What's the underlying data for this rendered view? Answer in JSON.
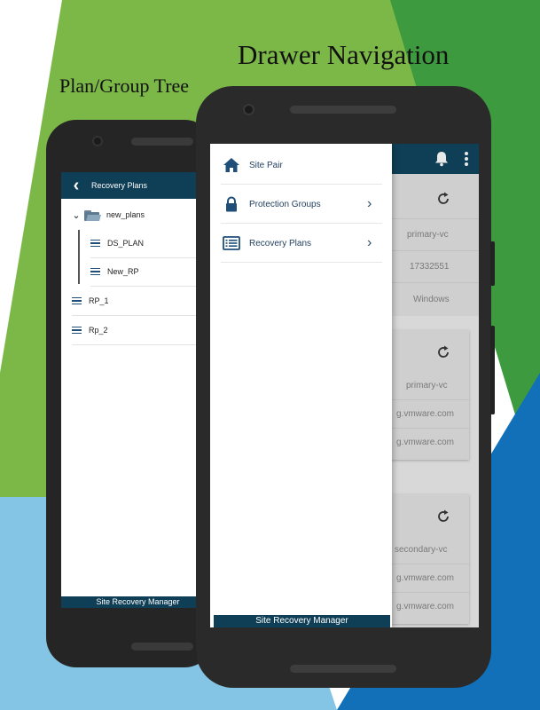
{
  "captions": {
    "left": "Plan/Group Tree",
    "right": "Drawer Navigation"
  },
  "colors": {
    "header": "#0f3f56",
    "bg_green_light": "#7cb847",
    "bg_green_dark": "#2f8f3c",
    "bg_blue_light": "#84c4e4",
    "bg_blue_dark": "#1170b8"
  },
  "back_screen": {
    "back_icon": "chevron-left-icon",
    "title": "Recovery Plans",
    "tree": {
      "folder": {
        "name": "new_plans",
        "icon": "folder-open-icon",
        "expand_icon": "chevron-down-icon"
      },
      "children": [
        "DS_PLAN",
        "New_RP"
      ],
      "root_items": [
        "RP_1",
        "Rp_2"
      ]
    },
    "footer": "Site Recovery Manager"
  },
  "front_screen": {
    "header_icons": [
      "bell-icon",
      "more-vert-icon"
    ],
    "cards": [
      {
        "values": [
          "primary-vc",
          "17332551",
          "Windows"
        ]
      },
      {
        "values": [
          "primary-vc",
          "g.vmware.com",
          "g.vmware.com"
        ]
      },
      {
        "values": [
          "secondary-vc",
          "g.vmware.com",
          "g.vmware.com"
        ]
      }
    ],
    "drawer": {
      "items": [
        {
          "label": "Site Pair",
          "icon": "home-icon",
          "has_chevron": false
        },
        {
          "label": "Protection Groups",
          "icon": "lock-icon",
          "has_chevron": true
        },
        {
          "label": "Recovery Plans",
          "icon": "list-icon",
          "has_chevron": true
        }
      ],
      "footer": "Site Recovery Manager"
    }
  }
}
